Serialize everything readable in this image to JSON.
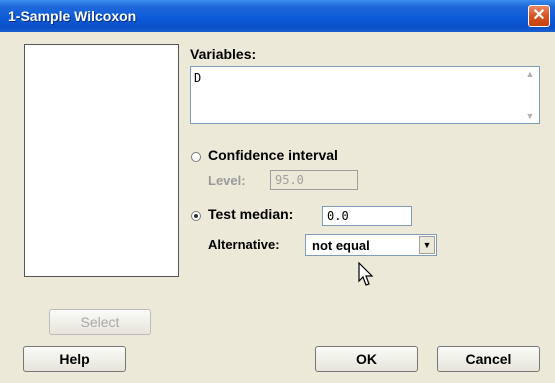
{
  "window": {
    "title": "1-Sample Wilcoxon",
    "close_icon": "close-icon"
  },
  "variables": {
    "label": "Variables:",
    "value": "D"
  },
  "confidence": {
    "label": "Confidence interval",
    "selected": false,
    "level_label": "Level:",
    "level_value": "95.0"
  },
  "test_median": {
    "label": "Test median:",
    "selected": true,
    "value": "0.0"
  },
  "alternative": {
    "label": "Alternative:",
    "value": "not equal"
  },
  "buttons": {
    "select": "Select",
    "help": "Help",
    "ok": "OK",
    "cancel": "Cancel"
  },
  "colors": {
    "titlebar": "#0c5bd8",
    "dialog_bg": "#ece9d8",
    "close_button": "#d9521f"
  }
}
